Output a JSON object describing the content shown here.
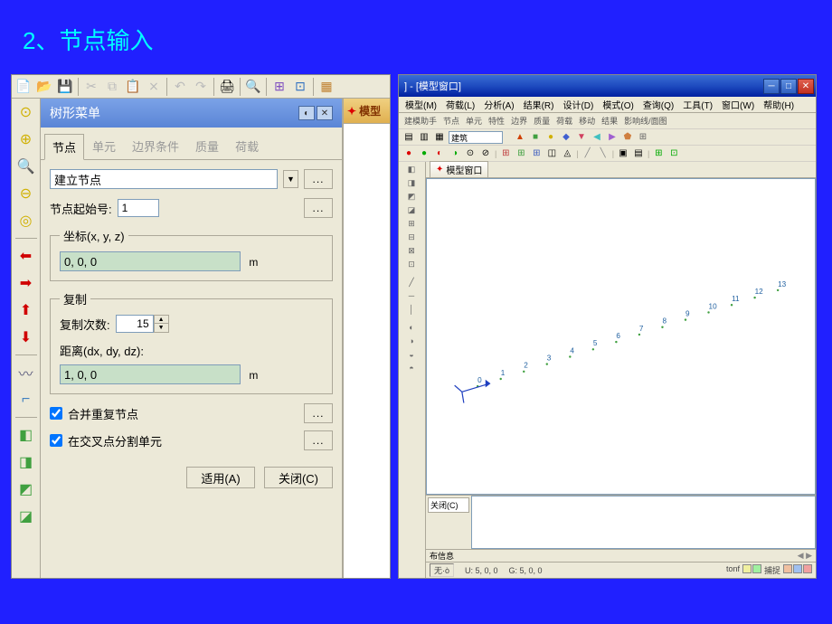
{
  "slide_title": "2、节点输入",
  "tree_panel": {
    "title": "树形菜单",
    "tabs": [
      "节点",
      "单元",
      "边界条件",
      "质量",
      "荷载"
    ],
    "active_tab": 0,
    "operation": {
      "label": "建立节点"
    },
    "start_num": {
      "label": "节点起始号:",
      "value": "1"
    },
    "coord_group": {
      "legend": "坐标(x, y, z)",
      "value": "0, 0, 0",
      "unit": "m"
    },
    "copy_group": {
      "legend": "复制",
      "times_label": "复制次数:",
      "times_value": "15",
      "dist_label": "距离(dx, dy, dz):",
      "dist_value": "1, 0, 0",
      "dist_unit": "m"
    },
    "merge_dup": {
      "label": "合并重复节点",
      "checked": true
    },
    "split_intersect": {
      "label": "在交叉点分割单元",
      "checked": true
    },
    "buttons": {
      "apply": "适用(A)",
      "close": "关闭(C)"
    },
    "more": "..."
  },
  "model_strip_title": "模型",
  "app_window": {
    "title": "] - [模型窗口]",
    "menu": [
      "模型(M)",
      "荷载(L)",
      "分析(A)",
      "结果(R)",
      "设计(D)",
      "模式(O)",
      "查询(Q)",
      "工具(T)",
      "窗口(W)",
      "帮助(H)"
    ],
    "submenu": [
      "建模助手",
      "节点",
      "单元",
      "特性",
      "边界",
      "质量",
      "荷载",
      "移动",
      "结果",
      "影响线/面图"
    ],
    "combo_label": "建筑",
    "view_tab": "模型窗口",
    "output_tab": "关闭(C)",
    "msg_tab": "布信息",
    "status": {
      "none": "无·ò",
      "u": "U: 5, 0, 0",
      "g": "G: 5, 0, 0",
      "unit1": "tonf",
      "scale": "捕捉"
    },
    "sb_colors": [
      "#f0f0a0",
      "#a0f0a0",
      "#f0c0a0",
      "#a0c0f0",
      "#f0a0a0"
    ]
  }
}
